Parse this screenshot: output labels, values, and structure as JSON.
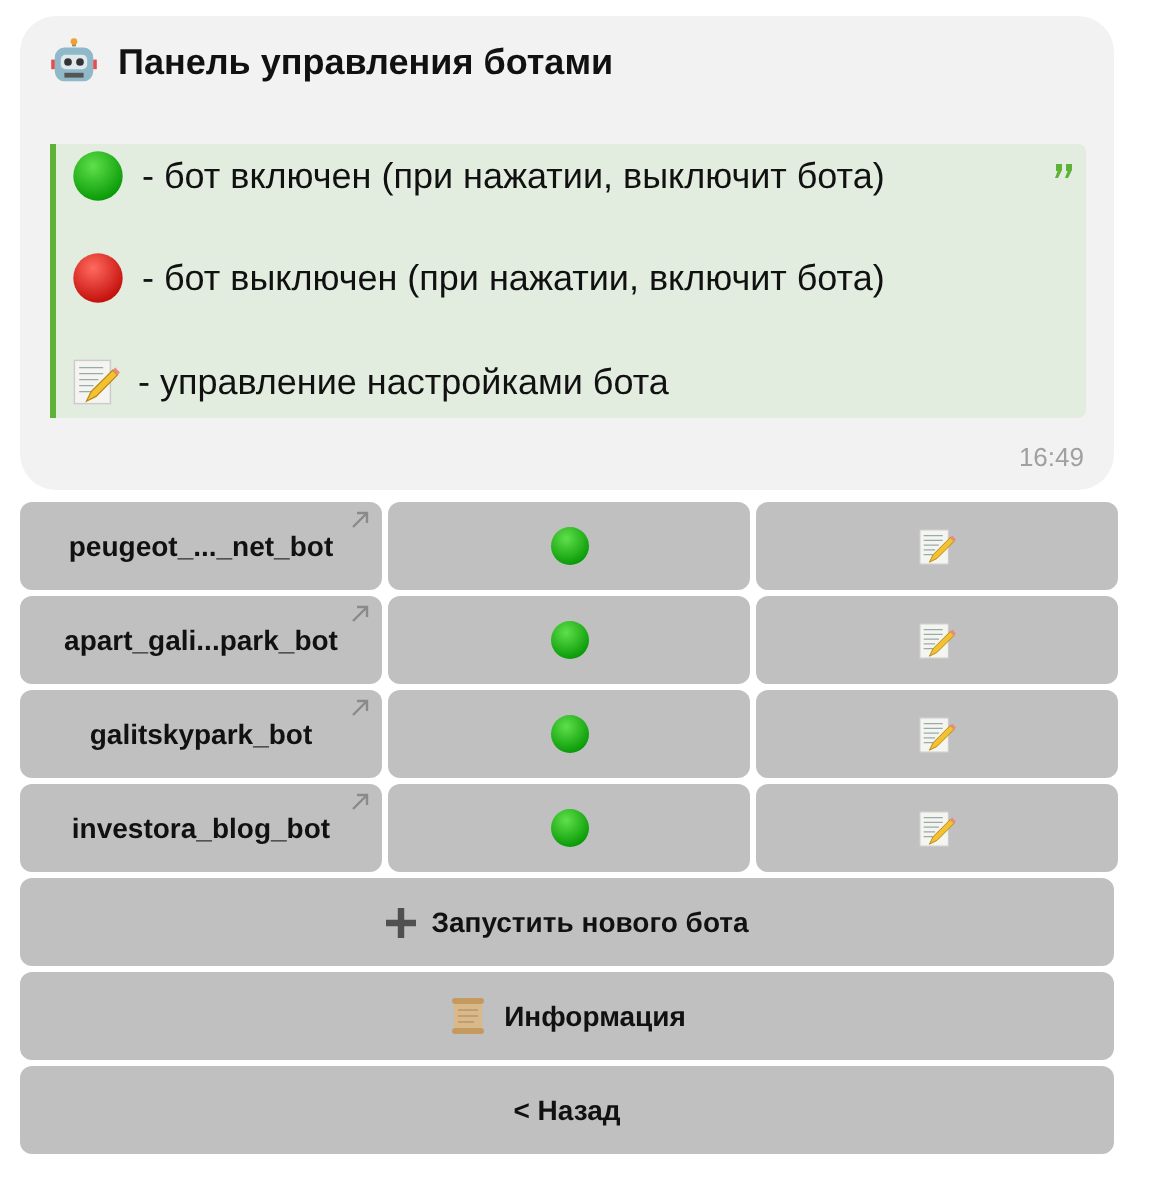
{
  "message": {
    "title": "Панель управления ботами",
    "legend": [
      {
        "kind": "on",
        "text": "- бот включен (при нажатии, выключит бота)"
      },
      {
        "kind": "off",
        "text": "- бот выключен (при нажатии, включит бота)"
      },
      {
        "kind": "edit",
        "text": "- управление настройками бота"
      }
    ],
    "time": "16:49"
  },
  "bots": [
    {
      "name": "peugeot_..._net_bot",
      "enabled": true
    },
    {
      "name": "apart_gali...park_bot",
      "enabled": true
    },
    {
      "name": "galitskypark_bot",
      "enabled": true
    },
    {
      "name": "investora_blog_bot",
      "enabled": true
    }
  ],
  "buttons": [
    {
      "kind": "add",
      "label": "Запустить нового бота"
    },
    {
      "kind": "info",
      "label": "Информация"
    },
    {
      "kind": "back",
      "label": "< Назад"
    }
  ]
}
